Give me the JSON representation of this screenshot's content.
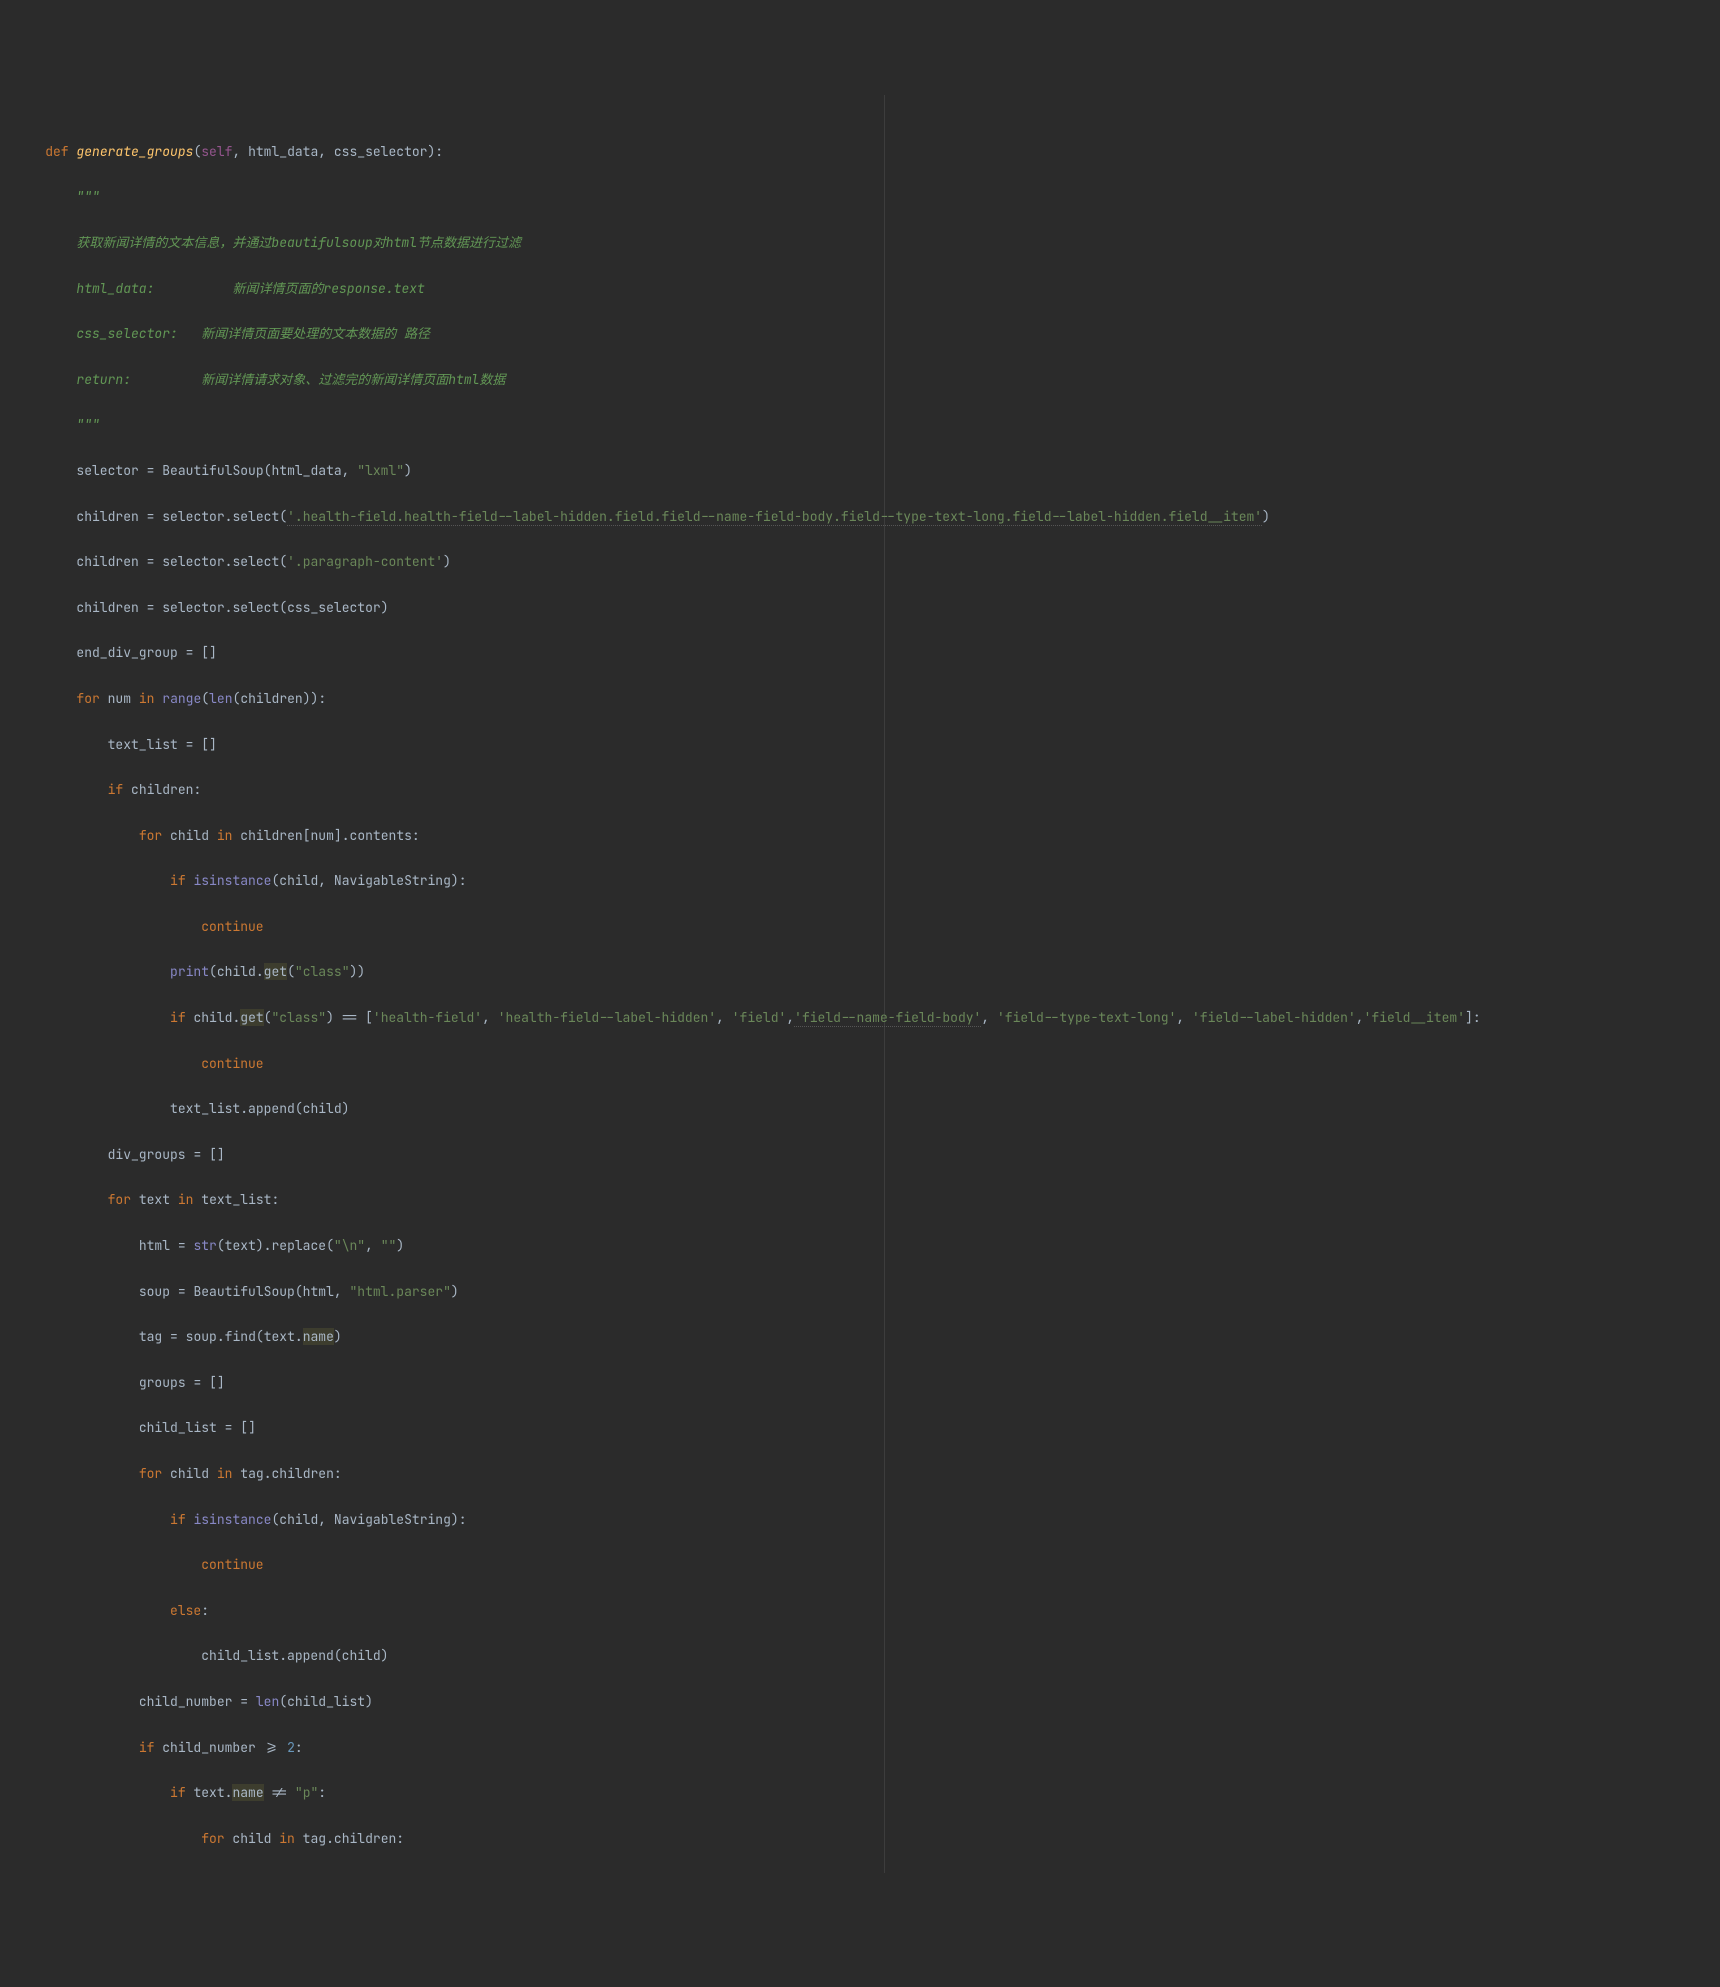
{
  "code": {
    "def_kw": "def",
    "fn_name": "generate_groups",
    "self_kw": "self",
    "param1": "html_data",
    "param2": "css_selector",
    "docq1": "\"\"\"",
    "doc_l1": "获取新闻详情的文本信息，并通过beautifulsoup对html节点数据进行过滤",
    "doc_l2a": "html_data:",
    "doc_l2b": "新闻详情页面的response.text",
    "doc_l3a": "css_selector:",
    "doc_l3b": "新闻详情页面要处理的文本数据的 路径",
    "doc_l4a": "return:",
    "doc_l4b": "新闻详情请求对象、过滤完的新闻详情页面html数据",
    "docq2": "\"\"\"",
    "selector": "selector",
    "BeautifulSoup": "BeautifulSoup",
    "lxml": "\"lxml\"",
    "children": "children",
    "select": "select",
    "sel_str1": "'.health-field.health-field--label-hidden.field.field--name-field-body.field--type-text-long.field--label-hidden.field__item'",
    "sel_str2": "'.paragraph-content'",
    "end_div_group": "end_div_group",
    "for_kw": "for",
    "in_kw": "in",
    "num_var": "num",
    "range_fn": "range",
    "len_fn": "len",
    "text_list": "text_list",
    "if_kw": "if",
    "child_var": "child",
    "contents": "contents",
    "isinstance_fn": "isinstance",
    "NavigableString": "NavigableString",
    "continue_kw": "continue",
    "print_fn": "print",
    "get_call": "get",
    "class_str": "\"class\"",
    "cls1": "'health-field'",
    "cls2": "'health-field--label-hidden'",
    "cls3": "'field'",
    "cls4": "'field--name-field-body'",
    "cls5": "'field--type-text-long'",
    "cls6": "'field--label-hidden'",
    "cls7": "'field__item'",
    "append": "append",
    "div_groups": "div_groups",
    "text_var": "text",
    "html_var": "html",
    "str_fn": "str",
    "replace": "replace",
    "nl_str": "\"\\n\"",
    "empty_str": "\"\"",
    "soup_var": "soup",
    "html_parser": "\"html.parser\"",
    "tag_var": "tag",
    "find": "find",
    "name_attr": "name",
    "groups_var": "groups",
    "child_list": "child_list",
    "children_attr": "children",
    "else_kw": "else",
    "child_number": "child_number",
    "two_num": "2",
    "ge_op": ">=",
    "ne_op": "!=",
    "p_str": "\"p\""
  }
}
